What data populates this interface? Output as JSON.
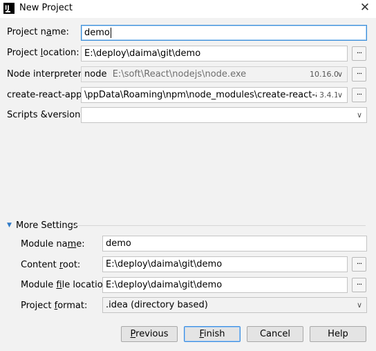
{
  "window": {
    "title": "New Project",
    "close_glyph": "✕"
  },
  "form": {
    "project_name": {
      "label_pre": "Project n",
      "label_mn": "a",
      "label_post": "me:",
      "value": "demo"
    },
    "project_location": {
      "label_pre": "Project ",
      "label_mn": "l",
      "label_post": "ocation:",
      "value": "E:\\deploy\\daima\\git\\demo"
    },
    "node_interpreter": {
      "label": "Node interpreter:",
      "value_name": "node",
      "value_path": "E:\\soft\\React\\nodejs\\node.exe",
      "version": "10.16.0"
    },
    "create_react_app": {
      "label": "create-react-app:",
      "value": "\\ppData\\Roaming\\npm\\node_modules\\create-react-app",
      "version": "3.4.1"
    },
    "scripts_version": {
      "label": "Scripts &version",
      "value": ""
    },
    "browse_label": "..."
  },
  "more_settings": {
    "title": "More Settings",
    "module_name": {
      "label_pre": "Module na",
      "label_mn": "m",
      "label_post": "e:",
      "value": "demo"
    },
    "content_root": {
      "label_pre": "Content ",
      "label_mn": "r",
      "label_post": "oot:",
      "value": "E:\\deploy\\daima\\git\\demo"
    },
    "module_file_location": {
      "label_pre": "Module ",
      "label_mn": "f",
      "label_post": "ile location:",
      "value": "E:\\deploy\\daima\\git\\demo"
    },
    "project_format": {
      "label_pre": "Project ",
      "label_mn": "f",
      "label_post": "ormat:",
      "value": ".idea (directory based)"
    }
  },
  "buttons": {
    "previous": {
      "mn": "P",
      "rest": "revious"
    },
    "finish": {
      "mn": "F",
      "rest": "inish"
    },
    "cancel": "Cancel",
    "help": "Help"
  }
}
